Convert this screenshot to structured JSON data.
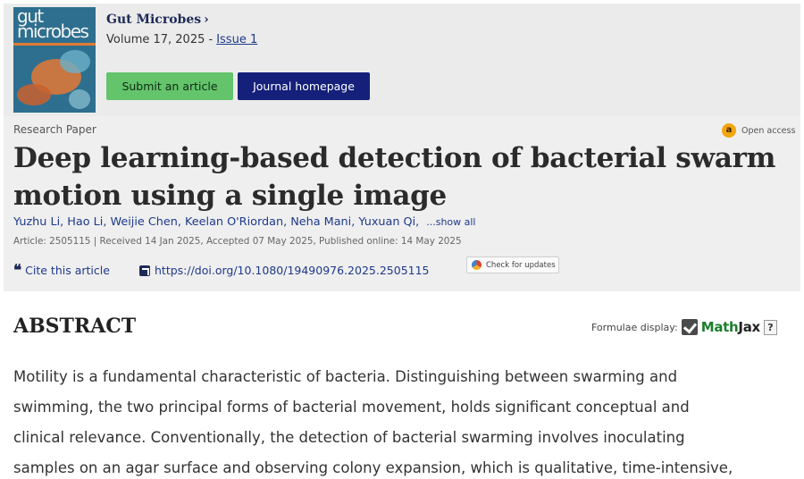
{
  "journal": {
    "cover_text": "gut microbes",
    "name": "Gut Microbes",
    "chevron": "›",
    "volume_text": "Volume 17, 2025 -",
    "issue_link": "Issue 1",
    "submit_button": "Submit an article",
    "homepage_button": "Journal homepage"
  },
  "article": {
    "type": "Research Paper",
    "open_access": {
      "icon": "open-access-icon",
      "label": "Open access"
    },
    "title": "Deep learning-based detection of bacterial swarm motion using a single image",
    "authors": "Yuzhu Li, Hao Li, Weijie Chen, Keelan O'Riordan, Neha Mani, Yuxuan Qi,",
    "show_all": "...show all",
    "meta": "Article: 2505115 | Received 14 Jan 2025, Accepted 07 May 2025, Published online: 14 May 2025",
    "cite_label": "Cite this article",
    "doi_link": "https://doi.org/10.1080/19490976.2025.2505115",
    "check_updates": "Check for updates"
  },
  "abstract": {
    "heading": "ABSTRACT",
    "formulae_label": "Formulae display:",
    "mathjax_math": "Math",
    "mathjax_jax": "Jax",
    "help": "?",
    "lines": [
      "Motility is a fundamental characteristic of bacteria. Distinguishing between swarming and",
      "swimming, the two principal forms of bacterial movement, holds significant conceptual and",
      "clinical relevance. Conventionally, the detection of bacterial swarming involves inoculating",
      "samples on an agar surface and observing colony expansion, which is qualitative, time-intensive,"
    ]
  },
  "colors": {
    "submit_green": "#63c46b",
    "homepage_navy": "#15207a",
    "link_blue": "#1d3a8c",
    "open_access_orange": "#f3a70f",
    "mathjax_green": "#1c7e2c"
  }
}
